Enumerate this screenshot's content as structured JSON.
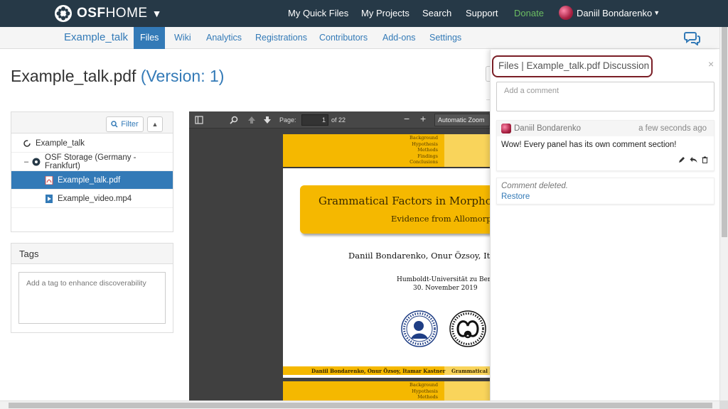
{
  "topnav": {
    "brand_prefix": "OSF",
    "brand_suffix": "HOME",
    "items": [
      "My Quick Files",
      "My Projects",
      "Search",
      "Support",
      "Donate"
    ],
    "user_name": "Daniil Bondarenko",
    "bg_color": "#263947",
    "donate_color": "#6cbc62"
  },
  "subnav": {
    "project_name": "Example_talk",
    "tabs": [
      "Files",
      "Wiki",
      "Analytics",
      "Registrations",
      "Contributors",
      "Add-ons",
      "Settings"
    ],
    "active_tab": "Files",
    "chat_icon": "comments-icon"
  },
  "file": {
    "name": "Example_talk.pdf",
    "version_label": "(Version: 1)"
  },
  "tree": {
    "filter_label": "Filter",
    "rows": [
      {
        "label": "Example_talk",
        "icon": "project-spinner-icon",
        "selected": false
      },
      {
        "label": "OSF Storage (Germany - Frankfurt)",
        "icon": "osf-storage-icon",
        "selected": false
      },
      {
        "label": "Example_talk.pdf",
        "icon": "pdf-file-icon",
        "selected": true
      },
      {
        "label": "Example_video.mp4",
        "icon": "video-file-icon",
        "selected": false
      }
    ]
  },
  "tags": {
    "heading": "Tags",
    "placeholder": "Add a tag to enhance discoverability"
  },
  "pdf_viewer": {
    "page_label": "Page:",
    "current_page": "1",
    "page_count": "of 22",
    "zoom": "Automatic Zoom",
    "slide": {
      "outline": [
        "Background",
        "Hypothesis",
        "Methods",
        "Findings",
        "Conclusions"
      ],
      "outline_next": [
        "Background",
        "Hypothesis",
        "Methods"
      ],
      "title": "Grammatical Factors in Morpholo",
      "subtitle": "Evidence from Allomorph",
      "authors": "Daniil Bondarenko, Onur Özsoy, Ita",
      "institution": "Humboldt-Universität zu Berli",
      "date": "30. November 2019",
      "footer_left": "Daniil Bondarenko, Onur Özsoy, Itamar Kastner",
      "footer_right": "Grammatical F"
    }
  },
  "discussion": {
    "title": "Files | Example_talk.pdf Discussion",
    "close": "×",
    "input_placeholder": "Add a comment",
    "comments": [
      {
        "author": "Daniil Bondarenko",
        "time": "a few seconds ago",
        "text": "Wow! Every panel has its own comment section!"
      }
    ],
    "deleted_text": "Comment deleted.",
    "restore_label": "Restore",
    "highlight_color": "#7a1e26"
  }
}
